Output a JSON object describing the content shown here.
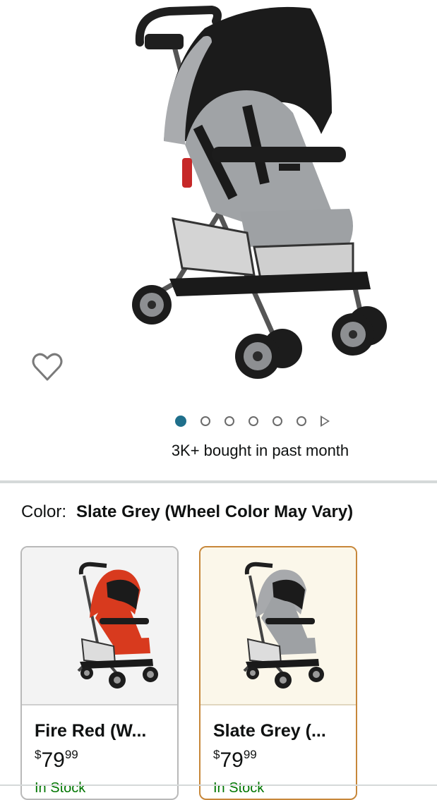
{
  "product": {
    "image_alt": "Slate Grey stroller",
    "carousel": {
      "count": 6,
      "active_index": 0
    },
    "social_proof": "3K+ bought in past month"
  },
  "color_selector": {
    "label": "Color:",
    "selected_value": "Slate Grey (Wheel Color May Vary)",
    "options": [
      {
        "name": "Fire Red (W...",
        "price_currency": "$",
        "price_whole": "79",
        "price_fraction": "99",
        "stock": "In Stock",
        "selected": false
      },
      {
        "name": "Slate Grey (...",
        "price_currency": "$",
        "price_whole": "79",
        "price_fraction": "99",
        "stock": "In Stock",
        "selected": true
      }
    ]
  },
  "colors": {
    "accent_dot": "#1f6f8b",
    "selected_border": "#c7873a",
    "stock_green": "#007600"
  },
  "icons": {
    "wishlist": "heart-outline-icon",
    "carousel_play": "play-triangle-icon"
  }
}
